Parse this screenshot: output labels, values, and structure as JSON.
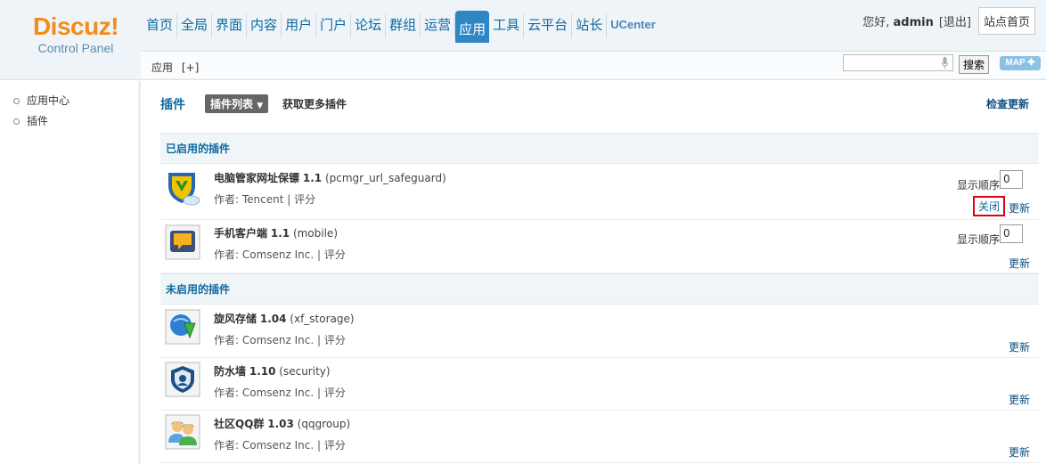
{
  "header": {
    "logo_main": "Discuz!",
    "logo_sub": "Control Panel",
    "nav": [
      "首页",
      "全局",
      "界面",
      "内容",
      "用户",
      "门户",
      "论坛",
      "群组",
      "运营",
      "应用",
      "工具",
      "云平台",
      "站长",
      "UCenter"
    ],
    "nav_active_index": 9,
    "greeting_prefix": "您好, ",
    "username": "admin",
    "logout_label": "[退出]",
    "site_home_label": "站点首页"
  },
  "subbar": {
    "crumb": "应用",
    "crumb_add": "[+]",
    "search_button": "搜索",
    "map_label": "MAP"
  },
  "sidebar": {
    "items": [
      {
        "label": "应用中心"
      },
      {
        "label": "插件"
      }
    ]
  },
  "main": {
    "title": "插件",
    "list_button": "插件列表",
    "list_caret": "▼",
    "more_plugins": "获取更多插件",
    "check_update": "检查更新",
    "enabled_header": "已启用的插件",
    "disabled_header": "未启用的插件",
    "order_label": "显示顺序:",
    "close_label": "关闭",
    "update_label": "更新",
    "enabled": [
      {
        "name": "电脑管家网址保镖",
        "version": "1.1",
        "ident": "(pcmgr_url_safeguard)",
        "author": "作者: Tencent",
        "rate": "评分",
        "order": "0"
      },
      {
        "name": "手机客户端",
        "version": "1.1",
        "ident": "(mobile)",
        "author": "作者: Comsenz Inc.",
        "rate": "评分",
        "order": "0"
      }
    ],
    "disabled": [
      {
        "name": "旋风存储",
        "version": "1.04",
        "ident": "(xf_storage)",
        "author": "作者: Comsenz Inc.",
        "rate": "评分"
      },
      {
        "name": "防水墙",
        "version": "1.10",
        "ident": "(security)",
        "author": "作者: Comsenz Inc.",
        "rate": "评分"
      },
      {
        "name": "社区QQ群",
        "version": "1.03",
        "ident": "(qqgroup)",
        "author": "作者: Comsenz Inc.",
        "rate": "评分"
      }
    ],
    "separator": "|"
  },
  "icons": {
    "pcmgr": "shield-icon",
    "mobile": "chat-bubble-icon",
    "xf_storage": "download-globe-icon",
    "security": "security-shield-icon",
    "qqgroup": "users-icon"
  }
}
